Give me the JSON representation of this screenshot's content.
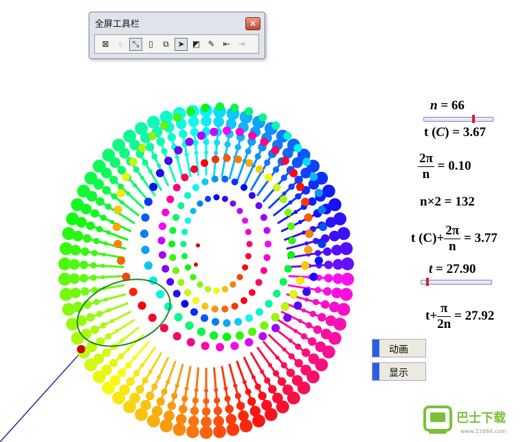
{
  "toolbar": {
    "title": "全屏工具栏",
    "close_label": "×",
    "tools": [
      {
        "name": "tool-hide",
        "glyph": "⊠",
        "state": "normal"
      },
      {
        "name": "tool-point",
        "glyph": "⬨",
        "state": "disabled"
      },
      {
        "name": "tool-compass",
        "glyph": "⤡",
        "state": "active"
      },
      {
        "name": "tool-measure",
        "glyph": "▯",
        "state": "normal"
      },
      {
        "name": "tool-copy",
        "glyph": "⧉",
        "state": "normal"
      },
      {
        "name": "tool-arrow",
        "glyph": "➤",
        "state": "active"
      },
      {
        "name": "tool-select",
        "glyph": "◩",
        "state": "normal"
      },
      {
        "name": "tool-pen",
        "glyph": "✎",
        "state": "normal"
      },
      {
        "name": "tool-back",
        "glyph": "⇤",
        "state": "normal"
      },
      {
        "name": "tool-forward",
        "glyph": "⇥",
        "state": "disabled"
      }
    ]
  },
  "measures": {
    "n_var": "n",
    "n_val": " = 66",
    "t_c_pre": "t (",
    "t_c_var": "C",
    "t_c_post": ") = 3.67",
    "frac1_num": "2π",
    "frac1_den": "n",
    "frac1_val": "= 0.10",
    "n_times_2": "n×2 = 132",
    "tc_plus_pre": "t (C)+",
    "frac2_num": "2π",
    "frac2_den": "n",
    "frac2_val": "= 3.77",
    "t_var": "t",
    "t_val": " = 27.90",
    "t_plus_pre": "t+",
    "frac3_num": "π",
    "frac3_den": "2n",
    "frac3_val": "= 27.92"
  },
  "sliders": {
    "n_slider_position": 0.72,
    "t_slider_position": 0.09
  },
  "buttons": {
    "animate": "动画",
    "show": "显示"
  },
  "watermark": {
    "brand": "巴士下载",
    "url": "www.11684.com"
  },
  "colors": {
    "accent_blue": "#2a60e0",
    "slider_knob": "#d2202a"
  }
}
